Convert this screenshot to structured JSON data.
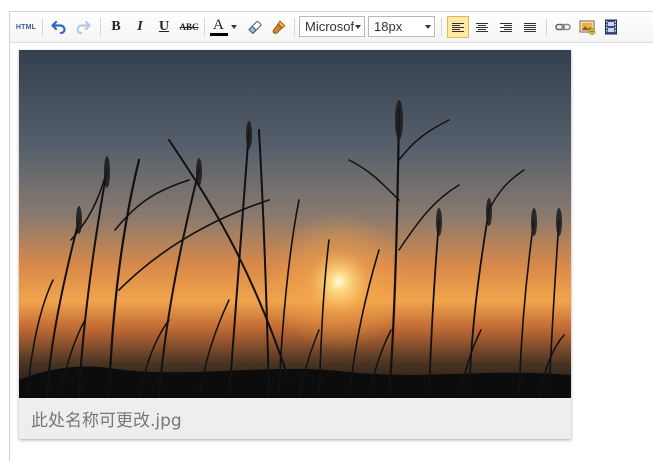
{
  "toolbar": {
    "html_label": "HTML",
    "bold_label": "B",
    "italic_label": "I",
    "underline_label": "U",
    "strike_label": "ABC",
    "font_color_label": "A",
    "font_family_value": "Microsoft YaHei",
    "font_size_value": "18px",
    "icons": [
      "undo-icon",
      "redo-icon",
      "eraser-icon",
      "brush-icon",
      "align-left-icon",
      "align-center-icon",
      "align-right-icon",
      "align-justify-icon",
      "link-icon",
      "image-icon",
      "video-icon"
    ],
    "font_color": "#000000",
    "active_highlight": "#ffe9a6"
  },
  "content": {
    "image_caption": "此处名称可更改.jpg"
  }
}
